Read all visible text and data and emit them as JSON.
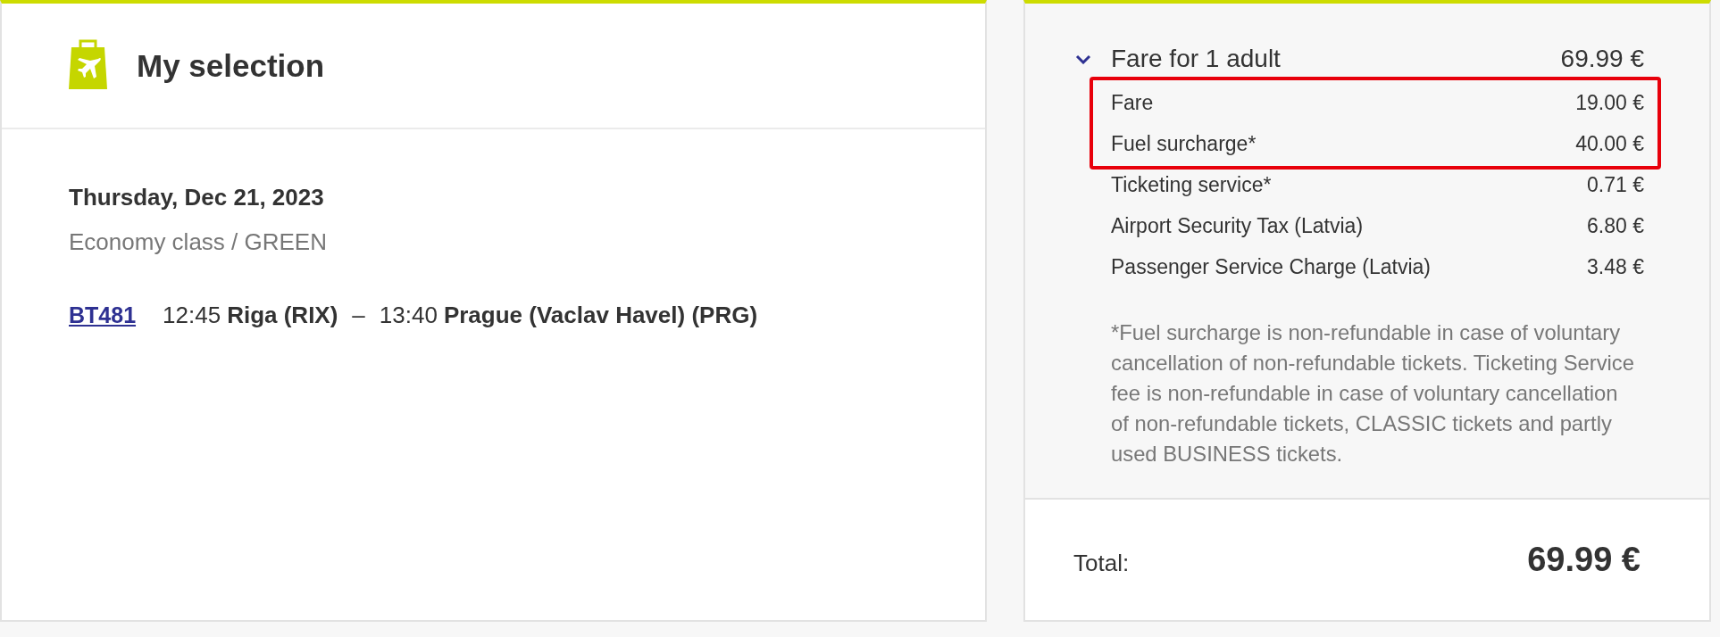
{
  "selection": {
    "title": "My selection",
    "date": "Thursday, Dec 21, 2023",
    "cabin": "Economy class / GREEN",
    "flight": {
      "number": "BT481",
      "departure_time": "12:45",
      "departure_airport": "Riga (RIX)",
      "separator": "–",
      "arrival_time": "13:40",
      "arrival_airport": "Prague (Vaclav Havel) (PRG)"
    }
  },
  "fare": {
    "heading": "Fare for 1 adult",
    "amount": "69.99 €",
    "expanded": true,
    "groups": [
      {
        "highlighted": true,
        "items": [
          {
            "label": "Fare",
            "amount": "19.00 €"
          },
          {
            "label": "Fuel surcharge*",
            "amount": "40.00 €"
          }
        ]
      },
      {
        "highlighted": false,
        "items": [
          {
            "label": "Ticketing service*",
            "amount": "0.71 €"
          },
          {
            "label": "Airport Security Tax (Latvia)",
            "amount": "6.80 €"
          },
          {
            "label": "Passenger Service Charge (Latvia)",
            "amount": "3.48 €"
          }
        ]
      }
    ],
    "footnote": "*Fuel surcharge is non-refundable in case of voluntary cancellation of non-refundable tickets. Ticketing Service fee is non-refundable in case of voluntary cancellation of non-refundable tickets, CLASSIC tickets and partly used BUSINESS tickets.",
    "total_label": "Total:",
    "total": "69.99 €"
  }
}
